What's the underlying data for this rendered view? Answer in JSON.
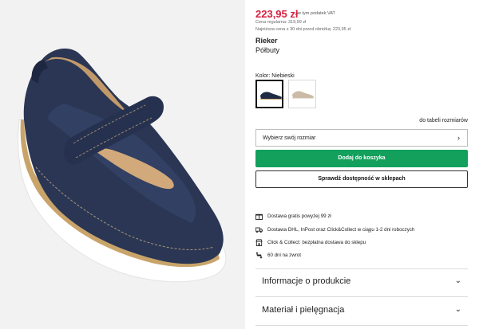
{
  "product": {
    "price": "223,95 zł",
    "price_vat_note": "w tym podatek VAT",
    "regular_price": "Cena regularna: 319,99 zł",
    "lowest_price": "Najniższa cena z 30 dni przed obniżką: 223,95 zł",
    "brand": "Rieker",
    "category": "Półbuty"
  },
  "colors": {
    "label": "Kolor: Niebieski",
    "options": [
      {
        "name": "navy-swatch",
        "color": "#1f2a44",
        "selected": true
      },
      {
        "name": "beige-swatch",
        "color": "#cbbba6",
        "selected": false
      }
    ]
  },
  "size": {
    "table_link": "do tabeli rozmiarów",
    "select_label": "Wybierz swój rozmiar",
    "chevron": "›"
  },
  "actions": {
    "add_to_cart": "Dodaj do koszyka",
    "check_store": "Sprawdź dostępność w sklepach"
  },
  "benefits": [
    {
      "icon": "gift-icon",
      "text": "Dostawa gratis powyżej 99 zł"
    },
    {
      "icon": "truck-icon",
      "text": "Dostawa DHL, InPost oraz Click&Collect w ciągu 1-2 dni roboczych"
    },
    {
      "icon": "store-icon",
      "text": "Click & Collect: bezpłatna dostawa do sklepu"
    },
    {
      "icon": "return-icon",
      "text": "60 dni na zwrot"
    }
  ],
  "accordions": [
    {
      "title": "Informacje o produkcie",
      "chevron": "⌄"
    },
    {
      "title": "Materiał i pielęgnacja",
      "chevron": "⌄"
    }
  ],
  "theme": {
    "price_color": "#d6203f",
    "cta_color": "#12a05c"
  }
}
